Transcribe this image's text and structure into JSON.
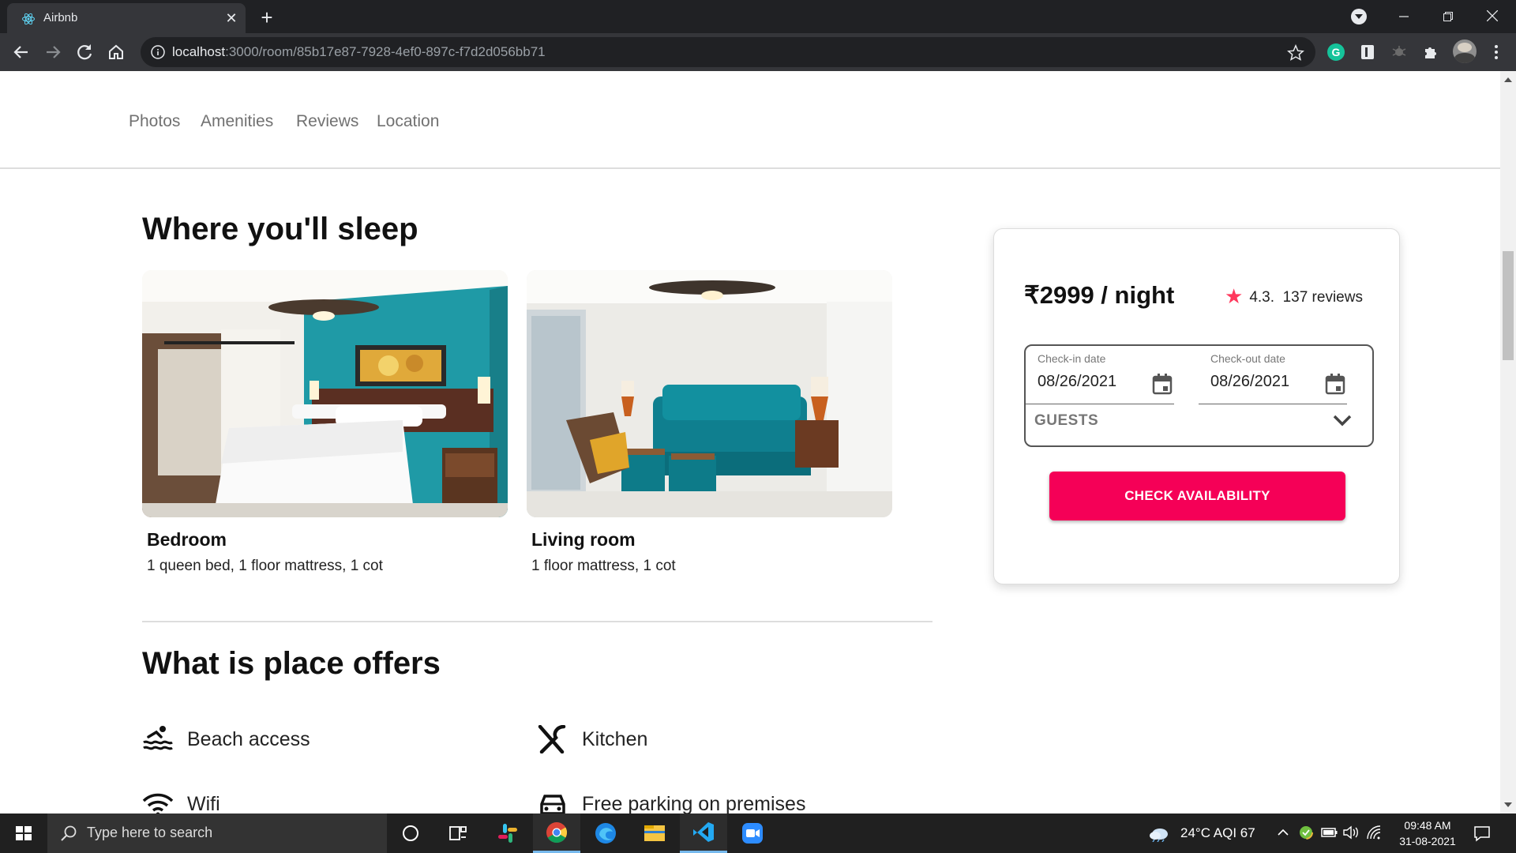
{
  "browser": {
    "tab_title": "Airbnb",
    "tab_close": "✕",
    "new_tab": "+",
    "url_host": "localhost",
    "url_path": ":3000/room/85b17e87-7928-4ef0-897c-f7d2d056bb71"
  },
  "subnav": {
    "links": [
      "Photos",
      "Amenities",
      "Reviews",
      "Location"
    ]
  },
  "sleep": {
    "heading": "Where you'll sleep",
    "rooms": [
      {
        "name": "Bedroom",
        "beds": "1 queen bed, 1 floor mattress, 1 cot"
      },
      {
        "name": "Living room",
        "beds": "1 floor mattress, 1 cot"
      }
    ]
  },
  "offers": {
    "heading": "What is place offers",
    "items": [
      {
        "label": "Beach access",
        "icon": "beach-icon"
      },
      {
        "label": "Kitchen",
        "icon": "utensils-icon"
      },
      {
        "label": "Wifi",
        "icon": "wifi-icon"
      },
      {
        "label": "Free parking on premises",
        "icon": "car-icon"
      }
    ]
  },
  "booking": {
    "price": "₹2999 / night",
    "rating": "4.3.",
    "reviews": "137 reviews",
    "checkin_label": "Check-in date",
    "checkin_value": "08/26/2021",
    "checkout_label": "Check-out date",
    "checkout_value": "08/26/2021",
    "guests_label": "GUESTS",
    "button": "CHECK AVAILABILITY"
  },
  "taskbar": {
    "search_placeholder": "Type here to search",
    "weather": "24°C  AQI 67",
    "time": "09:48 AM",
    "date": "31-08-2021"
  },
  "colors": {
    "brand": "#f50057",
    "star": "#ff385c",
    "chrome_dark": "#202124",
    "chrome_toolbar": "#35363a"
  }
}
